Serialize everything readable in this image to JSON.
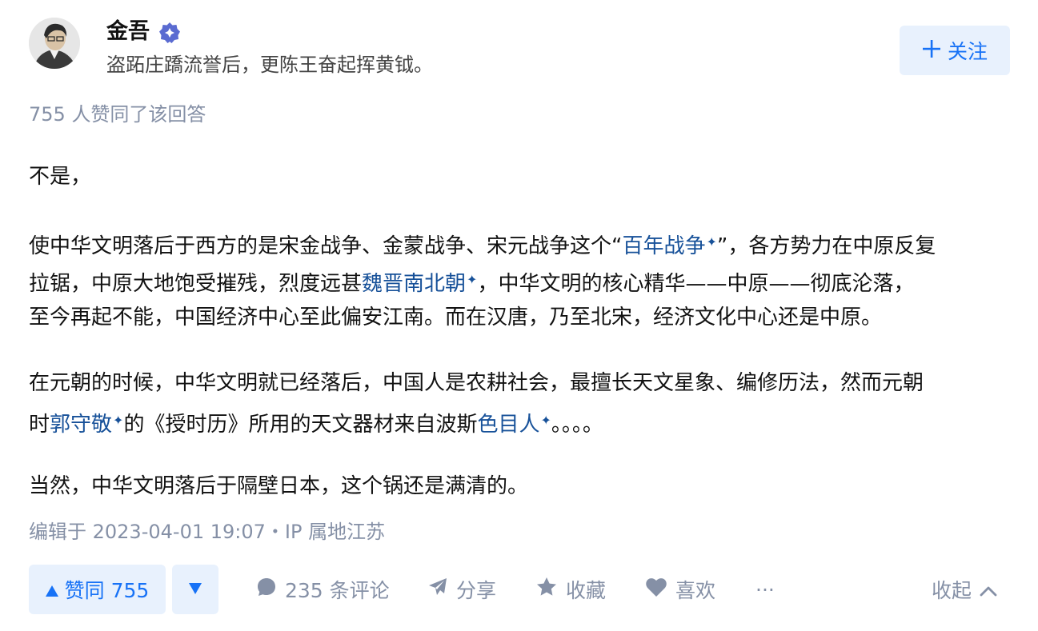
{
  "author": {
    "name": "金吾",
    "bio": "盗跖庄蹻流誉后，更陈王奋起挥黄钺。"
  },
  "follow_button": {
    "icon": "plus-icon",
    "label": "关注"
  },
  "agree_summary": "755 人赞同了该回答",
  "content": {
    "p1": "不是，",
    "p2": {
      "l1_a": "使中华文明落后于西方的是宋金战争、金蒙战争、宋元战争这个“",
      "l1_link": "百年战争",
      "l1_b": "”，各方势力在中原反复",
      "l2_a": "拉锯，中原大地饱受摧残，烈度远甚",
      "l2_link": "魏晋南北朝",
      "l2_b": "，中华文明的核心精华——中原——彻底沦落，",
      "l3": "至今再起不能，中国经济中心至此偏安江南。而在汉唐，乃至北宋，经济文化中心还是中原。"
    },
    "p3": {
      "l1": "在元朝的时候，中华文明就已经落后，中国人是农耕社会，最擅长天文星象、编修历法，然而元朝",
      "l2_a": "时",
      "l2_link1": "郭守敬",
      "l2_b": "的《授时历》所用的天文器材来自波斯",
      "l2_link2": "色目人",
      "l2_c": "。。。。"
    },
    "p4": "当然，中华文明落后于隔壁日本，这个锅还是满清的。",
    "link_marker": "✦"
  },
  "meta": "编辑于 2023-04-01 19:07・IP 属地江苏",
  "actions": {
    "vote_up": "赞同 755",
    "comments": "235 条评论",
    "share": "分享",
    "collect": "收藏",
    "like": "喜欢",
    "more": "···",
    "collapse": "收起"
  },
  "colors": {
    "accent": "#1772f6",
    "accent_bg": "#e8f1fd",
    "link": "#175199",
    "muted": "#8590a6",
    "badge": "#5a6bd1"
  }
}
